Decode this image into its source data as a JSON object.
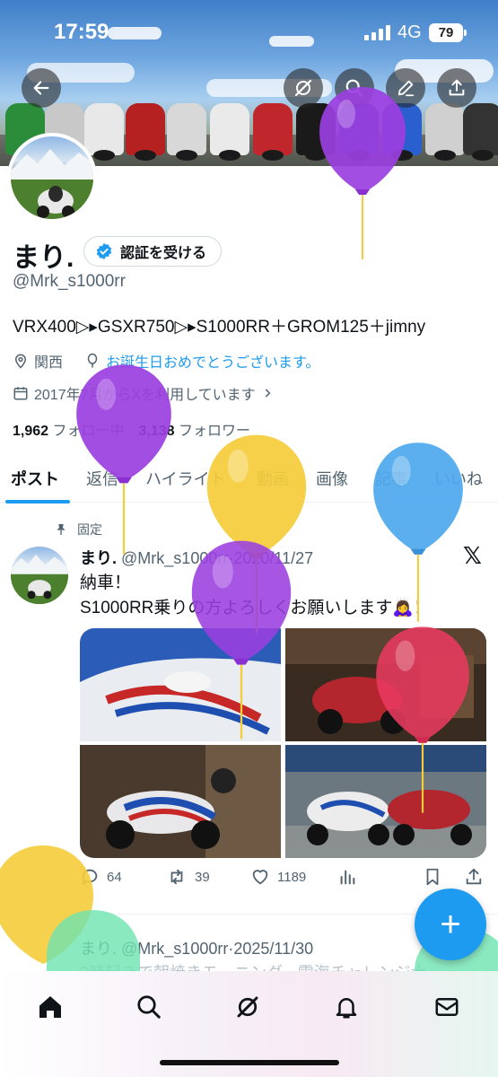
{
  "status_bar": {
    "time": "17:59",
    "network": "4G",
    "battery": "79"
  },
  "header_buttons": {
    "back": "back-arrow-icon",
    "grok": "grok-icon",
    "search": "search-icon",
    "edit": "pencil-icon",
    "share": "share-icon"
  },
  "profile": {
    "name": "まり.",
    "verify_label": "認証を受ける",
    "handle": "@Mrk_s1000rr",
    "bio": "VRX400▷▸GSXR750▷▸S1000RR＋GROM125＋jimny",
    "location": "関西",
    "birthday_text": "お誕生日おめでとうございます。",
    "joined": "2017年7月からXを利用しています",
    "following_count": "1,962",
    "following_label": "フォロー中",
    "followers_count": "3,138",
    "followers_label": "フォロワー"
  },
  "tabs": [
    "ポスト",
    "返信",
    "ハイライト",
    "動画",
    "画像",
    "記事",
    "いいね"
  ],
  "pinned_post": {
    "pinned_label": "固定",
    "author_name": "まり.",
    "author_handle": "@Mrk_s1000rr",
    "date": "2020/11/27",
    "text_line1": "納車！",
    "text_line2": "S1000RR乗りの方よろしくお願いします🙇‍♀️！",
    "replies": "64",
    "reposts": "39",
    "likes": "1189"
  },
  "next_post": {
    "author_name": "まり.",
    "author_handle": "@Mrk_s1000rr",
    "date": "2025/11/30",
    "text": "3時起きで朝焼きモーニング、雲海チャレンジ大"
  },
  "fab_label": "+",
  "bottom_nav": [
    "home-icon",
    "search-icon",
    "grok-icon",
    "bell-icon",
    "mail-icon"
  ],
  "colors": {
    "accent": "#1d9bf0",
    "text": "#0f1419",
    "muted": "#536471",
    "balloon_purple": "#9b3fe0",
    "balloon_yellow": "#f5cc3a",
    "balloon_blue": "#4da8ee",
    "balloon_red": "#e83a5e",
    "balloon_green": "#6ee4b0"
  }
}
